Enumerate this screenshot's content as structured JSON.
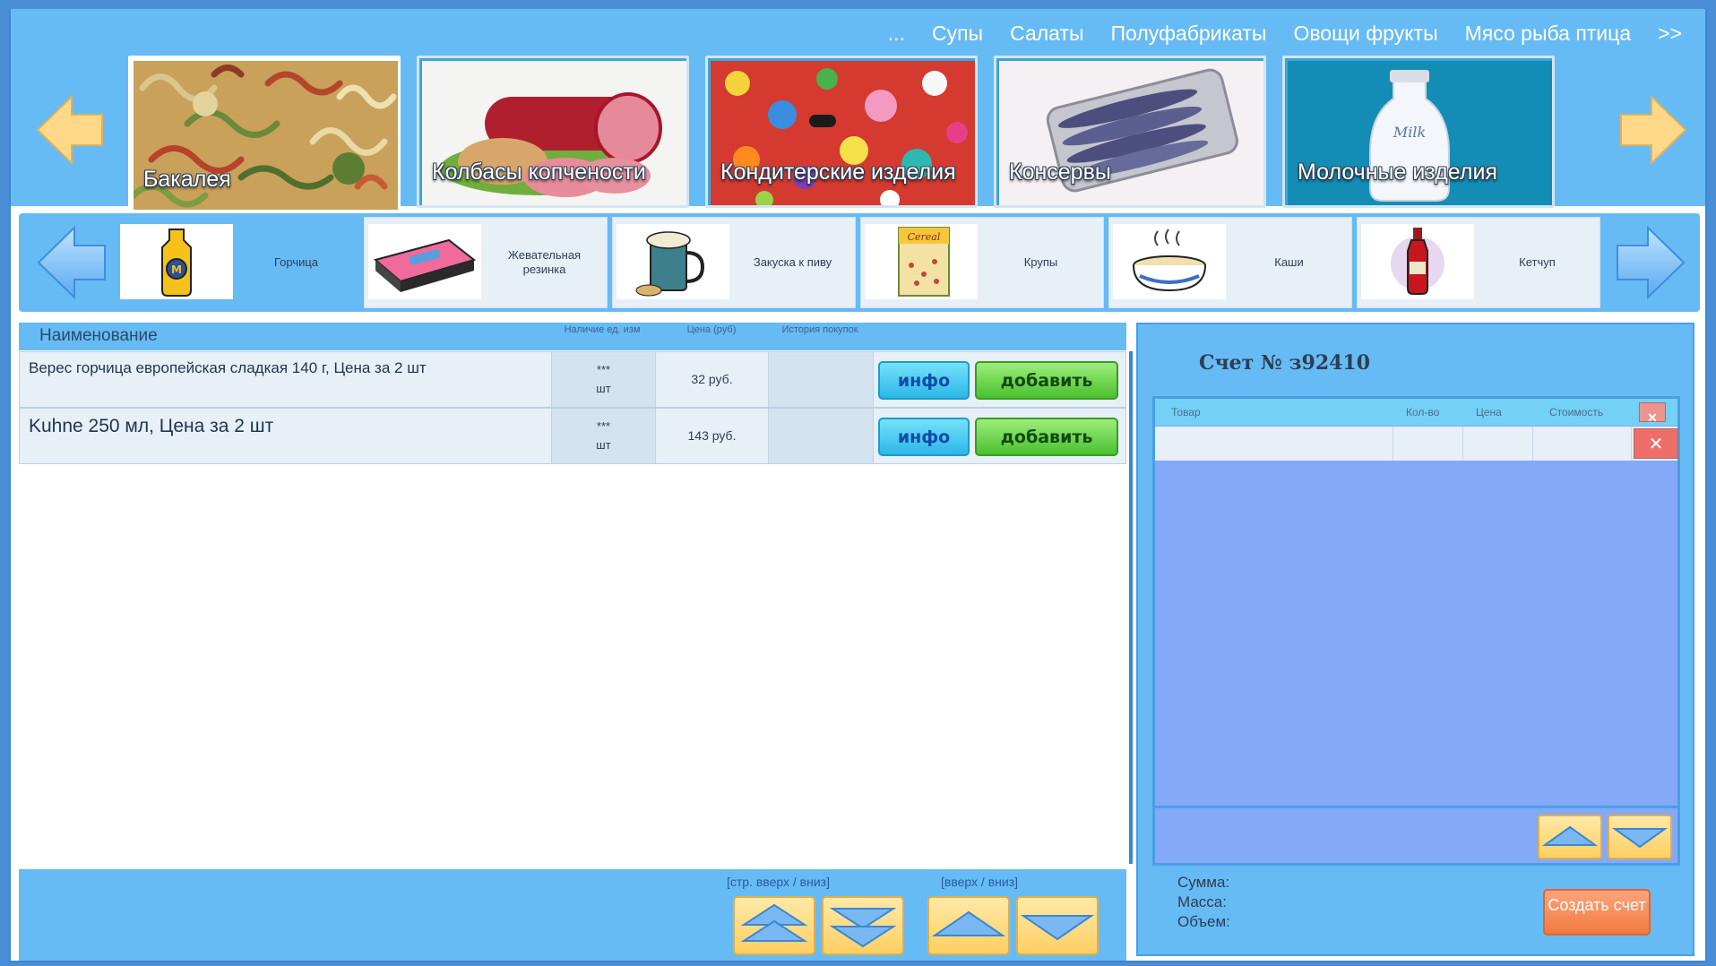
{
  "top_nav": {
    "items": [
      "...",
      "Супы",
      "Салаты",
      "Полуфабрикаты",
      "Овощи фрукты",
      "Мясо рыба птица",
      ">>"
    ]
  },
  "categories": [
    {
      "label": "Бакалея",
      "icon": "pasta-image",
      "active": true
    },
    {
      "label": "Колбасы копчености",
      "icon": "sausage-image"
    },
    {
      "label": "Кондитерские изделия",
      "icon": "candy-image"
    },
    {
      "label": "Консервы",
      "icon": "canned-fish-image"
    },
    {
      "label": "Молочные изделия",
      "icon": "milk-bottle-image",
      "image_text": "Milk"
    }
  ],
  "subcategories": [
    {
      "label": "Горчица",
      "icon": "mustard-icon",
      "active": true
    },
    {
      "label": "Жевательная резинка",
      "icon": "chewing-gum-icon"
    },
    {
      "label": "Закуска к пиву",
      "icon": "beer-mug-icon"
    },
    {
      "label": "Крупы",
      "icon": "cereal-box-icon",
      "image_text": "Cereal"
    },
    {
      "label": "Каши",
      "icon": "porridge-bowl-icon"
    },
    {
      "label": "Кетчуп",
      "icon": "ketchup-bottle-icon"
    }
  ],
  "product_table": {
    "headers": {
      "name": "Наименование",
      "stock": "Наличие ед. изм",
      "price": "Цена (руб)",
      "history": "История покупок"
    },
    "rows": [
      {
        "name": "Верес горчица европейская сладкая 140 г, Цена за 2 шт",
        "stock": "***",
        "unit": "шт",
        "price": "32 руб.",
        "history": "",
        "info_label": "инфо",
        "add_label": "добавить"
      },
      {
        "name": "Kuhne 250 мл, Цена за 2 шт",
        "stock": "***",
        "unit": "шт",
        "price": "143 руб.",
        "history": "",
        "info_label": "инфо",
        "add_label": "добавить"
      }
    ]
  },
  "pager": {
    "page_hint": "[стр. вверх / вниз]",
    "line_hint": "[вверх / вниз]"
  },
  "invoice": {
    "title": "Счет № з92410",
    "columns": [
      "Товар",
      "Кол-во",
      "Цена",
      "Стоимость"
    ],
    "totals": {
      "sum_label": "Сумма:",
      "mass_label": "Масса:",
      "volume_label": "Объем:"
    },
    "create_label": "Создать счет"
  },
  "colors": {
    "accent_blue": "#66bbf5",
    "frame_blue": "#4a8fd6",
    "info_button": "#2db7e6",
    "add_button": "#4bc02f",
    "create_button": "#f07a40",
    "arrow_yellow": "#ffcf63"
  }
}
